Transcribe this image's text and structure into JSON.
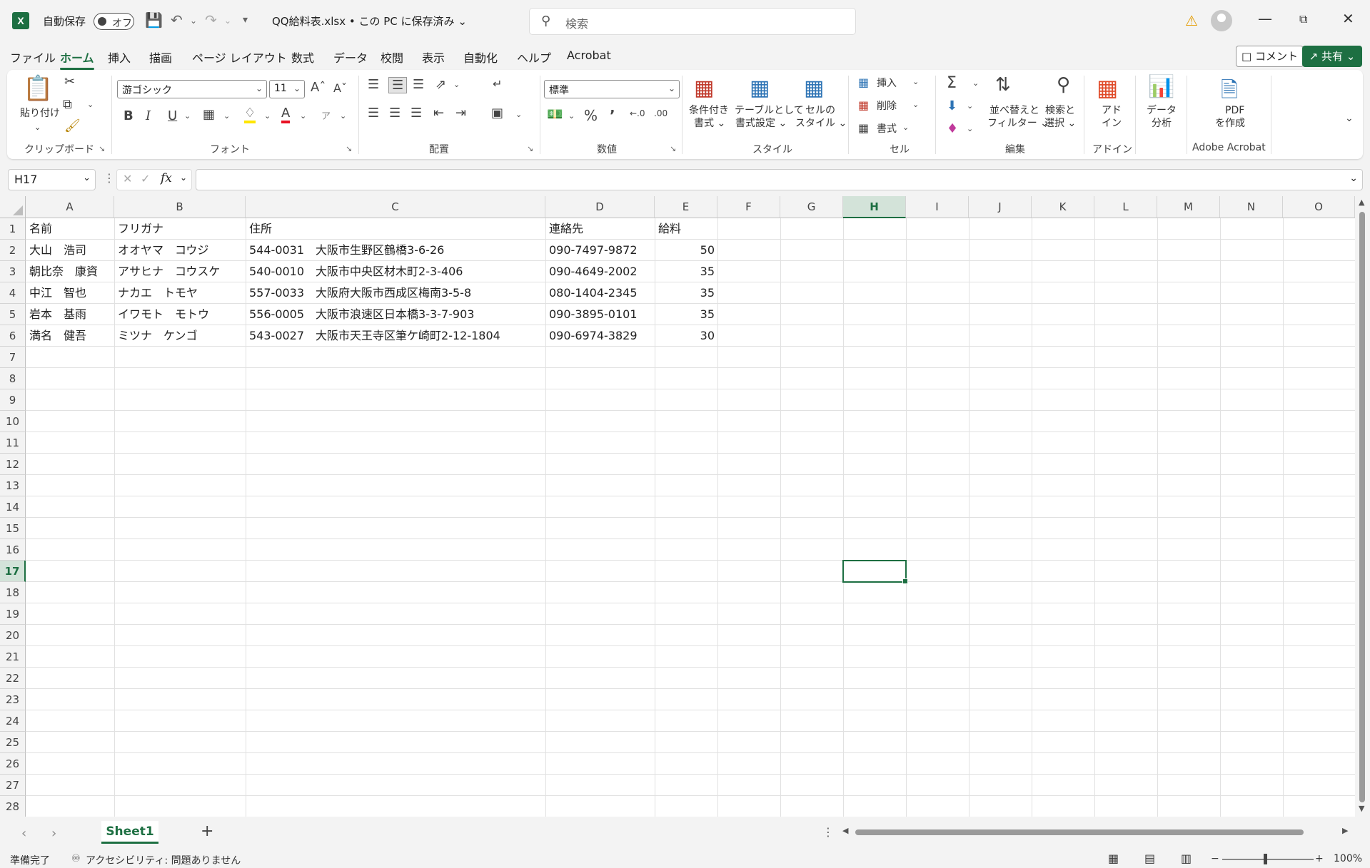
{
  "titlebar": {
    "autosave_label": "自動保存",
    "autosave_state": "オフ",
    "file_title": "QQ給料表.xlsx • この PC に保存済み ⌄",
    "search_placeholder": "検索"
  },
  "menu": {
    "tabs": [
      "ファイル",
      "ホーム",
      "挿入",
      "描画",
      "ページ レイアウト",
      "数式",
      "データ",
      "校閲",
      "表示",
      "自動化",
      "ヘルプ",
      "Acrobat"
    ],
    "active": "ホーム",
    "comment_label": "コメント",
    "share_label": "共有"
  },
  "ribbon": {
    "clipboard": {
      "label": "クリップボード",
      "paste": "貼り付け"
    },
    "font": {
      "label": "フォント",
      "font_name": "游ゴシック",
      "font_size": "11"
    },
    "alignment": {
      "label": "配置"
    },
    "number": {
      "label": "数値",
      "format": "標準"
    },
    "styles": {
      "label": "スタイル",
      "cond_format_1": "条件付き",
      "cond_format_2": "書式 ⌄",
      "table_1": "テーブルとして",
      "table_2": "書式設定 ⌄",
      "cell_style_1": "セルの",
      "cell_style_2": "スタイル ⌄"
    },
    "cells": {
      "label": "セル",
      "insert": "挿入",
      "delete": "削除",
      "format": "書式"
    },
    "editing": {
      "label": "編集",
      "sort_1": "並べ替えと",
      "sort_2": "フィルター ⌄",
      "find_1": "検索と",
      "find_2": "選択 ⌄"
    },
    "addins": {
      "label": "アドイン",
      "btn_1": "アド",
      "btn_2": "イン"
    },
    "analysis": {
      "btn_1": "データ",
      "btn_2": "分析"
    },
    "acrobat": {
      "label": "Adobe Acrobat",
      "btn_1": "PDF",
      "btn_2": "を作成"
    }
  },
  "formula_bar": {
    "name_box": "H17",
    "formula": ""
  },
  "sheet": {
    "columns": [
      "A",
      "B",
      "C",
      "D",
      "E",
      "F",
      "G",
      "H",
      "I",
      "J",
      "K",
      "L",
      "M",
      "N",
      "O"
    ],
    "selected_column": "H",
    "selected_row": 17,
    "rows": [
      "1",
      "2",
      "3",
      "4",
      "5",
      "6",
      "7",
      "8",
      "9",
      "10",
      "11",
      "12",
      "13",
      "14",
      "15",
      "16",
      "17",
      "18",
      "19",
      "20",
      "21",
      "22",
      "23",
      "24",
      "25",
      "26",
      "27",
      "28"
    ],
    "header": {
      "name": "名前",
      "kana": "フリガナ",
      "address": "住所",
      "contact": "連絡先",
      "salary": "給料"
    },
    "data": [
      {
        "name": "大山　浩司",
        "kana": "オオヤマ　コウジ",
        "address": "544-0031　大阪市生野区鶴橋3-6-26",
        "contact": "090-7497-9872",
        "salary": "50"
      },
      {
        "name": "朝比奈　康資",
        "kana": "アサヒナ　コウスケ",
        "address": "540-0010　大阪市中央区材木町2-3-406",
        "contact": "090-4649-2002",
        "salary": "35"
      },
      {
        "name": "中江　智也",
        "kana": "ナカエ　トモヤ",
        "address": "557-0033　大阪府大阪市西成区梅南3-5-8",
        "contact": "080-1404-2345",
        "salary": "35"
      },
      {
        "name": "岩本　基雨",
        "kana": "イワモト　モトウ",
        "address": "556-0005　大阪市浪速区日本橋3-3-7-903",
        "contact": "090-3895-0101",
        "salary": "35"
      },
      {
        "name": "満名　健吾",
        "kana": "ミツナ　ケンゴ",
        "address": "543-0027　大阪市天王寺区筆ケ崎町2-12-1804",
        "contact": "090-6974-3829",
        "salary": "30"
      }
    ]
  },
  "sheet_tabs": {
    "active": "Sheet1",
    "add": "+"
  },
  "status": {
    "ready": "準備完了",
    "accessibility": "アクセシビリティ: 問題ありません",
    "zoom": "100%"
  },
  "colors": {
    "accent": "#1d6f42",
    "warning": "#e39b00"
  }
}
